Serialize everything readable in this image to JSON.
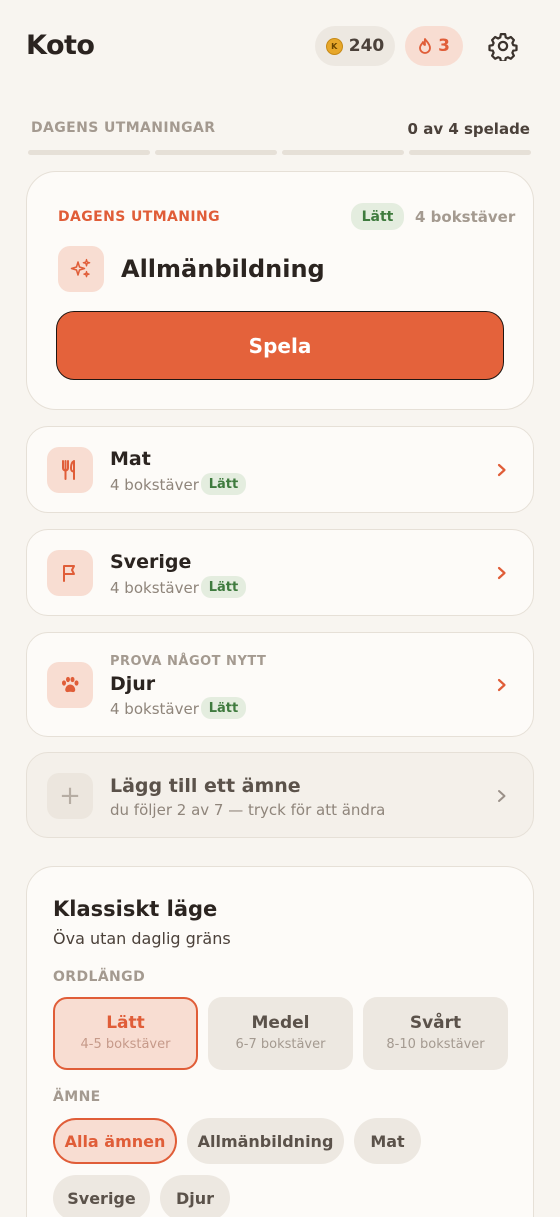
{
  "header": {
    "logo": "Koto",
    "coins": "240",
    "coin_symbol": "K",
    "streak": "3"
  },
  "progress": {
    "label": "DAGENS UTMANINGAR",
    "count": "0 av 4 spelade",
    "completed": 0,
    "total": 4
  },
  "daily": {
    "label": "DAGENS UTMANING",
    "difficulty": "Lätt",
    "letters": "4 bokstäver",
    "title": "Allmänbildning",
    "icon": "sparkles-icon",
    "play_label": "Spela"
  },
  "topics": [
    {
      "kicker": "",
      "title": "Mat",
      "letters": "4 bokstäver",
      "difficulty": "Lätt",
      "icon": "cutlery-icon"
    },
    {
      "kicker": "",
      "title": "Sverige",
      "letters": "4 bokstäver",
      "difficulty": "Lätt",
      "icon": "flag-icon"
    },
    {
      "kicker": "PROVA NÅGOT NYTT",
      "title": "Djur",
      "letters": "4 bokstäver",
      "difficulty": "Lätt",
      "icon": "paw-icon"
    }
  ],
  "add_topic": {
    "icon": "+",
    "title": "Lägg till ett ämne",
    "subtitle": "du följer 2 av 7 — tryck för att ändra"
  },
  "classic": {
    "title": "Klassiskt läge",
    "subtitle": "Öva utan daglig gräns",
    "length_label": "ORDLÄNGD",
    "lengths": [
      {
        "title": "Lätt",
        "sub": "4-5 bokstäver",
        "selected": true
      },
      {
        "title": "Medel",
        "sub": "6-7 bokstäver",
        "selected": false
      },
      {
        "title": "Svårt",
        "sub": "8-10 bokstäver",
        "selected": false
      }
    ],
    "topic_label": "ÄMNE",
    "topics": [
      "Alla ämnen",
      "Allmänbildning",
      "Mat",
      "Sverige",
      "Djur"
    ],
    "selected_topic": "Alla ämnen"
  },
  "colors": {
    "accent": "#e4623b",
    "background": "#f8f5f0",
    "easy_badge_bg": "#e4eddf",
    "easy_badge_text": "#3f7b3e"
  }
}
